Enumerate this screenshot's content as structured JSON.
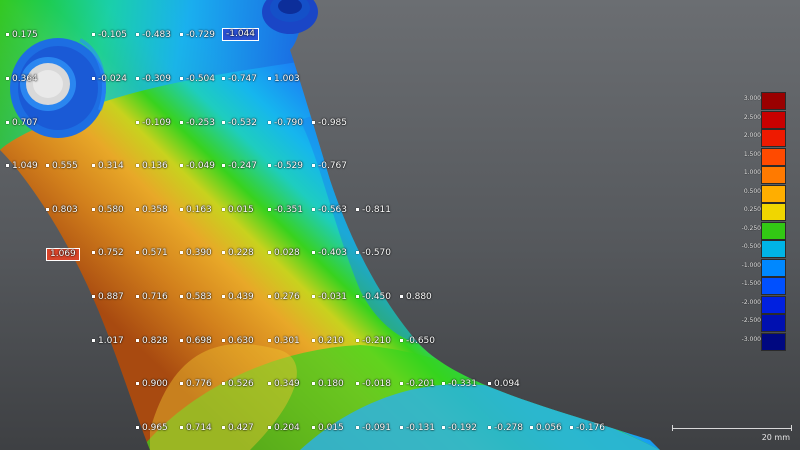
{
  "viewport": {
    "title": "",
    "model": "deviation-colormap-part"
  },
  "labels": [
    {
      "id": "r0c0",
      "text": "0.175"
    },
    {
      "id": "r0c1",
      "text": "-0.105"
    },
    {
      "id": "r0c2",
      "text": "-0.483"
    },
    {
      "id": "r0c3",
      "text": "-0.729"
    },
    {
      "id": "r0c4",
      "text": "-1.044",
      "hl": "blue"
    },
    {
      "id": "r1c0",
      "text": "0.364"
    },
    {
      "id": "r1c1",
      "text": "-0.024"
    },
    {
      "id": "r1c2",
      "text": "-0.309"
    },
    {
      "id": "r1c3",
      "text": "-0.504"
    },
    {
      "id": "r1c4",
      "text": "-0.747"
    },
    {
      "id": "r1c5",
      "text": "1.003"
    },
    {
      "id": "r2c0",
      "text": "0.707"
    },
    {
      "id": "r2c1",
      "text": "-0.109"
    },
    {
      "id": "r2c2",
      "text": "-0.253"
    },
    {
      "id": "r2c3",
      "text": "-0.532"
    },
    {
      "id": "r2c4",
      "text": "-0.790"
    },
    {
      "id": "r2c5",
      "text": "-0.985"
    },
    {
      "id": "r3c0",
      "text": "1.049"
    },
    {
      "id": "r3c1",
      "text": "0.555"
    },
    {
      "id": "r3c2",
      "text": "0.314"
    },
    {
      "id": "r3c3",
      "text": "0.136"
    },
    {
      "id": "r3c4",
      "text": "-0.049"
    },
    {
      "id": "r3c5",
      "text": "-0.247"
    },
    {
      "id": "r3c6",
      "text": "-0.529"
    },
    {
      "id": "r3c7",
      "text": "-0.767"
    },
    {
      "id": "r4c0",
      "text": "0.803"
    },
    {
      "id": "r4c1",
      "text": "0.580"
    },
    {
      "id": "r4c2",
      "text": "0.358"
    },
    {
      "id": "r4c3",
      "text": "0.163"
    },
    {
      "id": "r4c4",
      "text": "0.015"
    },
    {
      "id": "r4c5",
      "text": "-0.351"
    },
    {
      "id": "r4c6",
      "text": "-0.563"
    },
    {
      "id": "r4c7",
      "text": "-0.811"
    },
    {
      "id": "r5c0",
      "text": "1.069",
      "hl": "red"
    },
    {
      "id": "r5c1",
      "text": "0.752"
    },
    {
      "id": "r5c2",
      "text": "0.571"
    },
    {
      "id": "r5c3",
      "text": "0.390"
    },
    {
      "id": "r5c4",
      "text": "0.228"
    },
    {
      "id": "r5c5",
      "text": "0.028"
    },
    {
      "id": "r5c6",
      "text": "-0.403"
    },
    {
      "id": "r5c7",
      "text": "-0.570"
    },
    {
      "id": "r6c0",
      "text": "0.887"
    },
    {
      "id": "r6c1",
      "text": "0.716"
    },
    {
      "id": "r6c2",
      "text": "0.583"
    },
    {
      "id": "r6c3",
      "text": "0.439"
    },
    {
      "id": "r6c4",
      "text": "0.276"
    },
    {
      "id": "r6c5",
      "text": "-0.031"
    },
    {
      "id": "r6c6",
      "text": "-0.450"
    },
    {
      "id": "r6c7",
      "text": "0.880"
    },
    {
      "id": "r7c0",
      "text": "1.017"
    },
    {
      "id": "r7c1",
      "text": "0.828"
    },
    {
      "id": "r7c2",
      "text": "0.698"
    },
    {
      "id": "r7c3",
      "text": "0.630"
    },
    {
      "id": "r7c4",
      "text": "0.301"
    },
    {
      "id": "r7c5",
      "text": "0.210"
    },
    {
      "id": "r7c6",
      "text": "-0.210"
    },
    {
      "id": "r7c7",
      "text": "-0.650"
    },
    {
      "id": "r8c0",
      "text": "0.900"
    },
    {
      "id": "r8c1",
      "text": "0.776"
    },
    {
      "id": "r8c2",
      "text": "0.526"
    },
    {
      "id": "r8c3",
      "text": "0.349"
    },
    {
      "id": "r8c4",
      "text": "0.180"
    },
    {
      "id": "r8c5",
      "text": "-0.018"
    },
    {
      "id": "r8c6",
      "text": "-0.201"
    },
    {
      "id": "r8c7",
      "text": "-0.331"
    },
    {
      "id": "r8c8",
      "text": "0.094"
    },
    {
      "id": "r9c0",
      "text": "0.965"
    },
    {
      "id": "r9c1",
      "text": "0.714"
    },
    {
      "id": "r9c2",
      "text": "0.427"
    },
    {
      "id": "r9c3",
      "text": "0.204"
    },
    {
      "id": "r9c4",
      "text": "0.015"
    },
    {
      "id": "r9c5",
      "text": "-0.091"
    },
    {
      "id": "r9c6",
      "text": "-0.131"
    },
    {
      "id": "r9c7",
      "text": "-0.192"
    },
    {
      "id": "r9c8",
      "text": "-0.278"
    },
    {
      "id": "r9c9",
      "text": "0.056"
    },
    {
      "id": "r9c10",
      "text": "-0.176"
    }
  ],
  "legend": {
    "entries": [
      {
        "label": "3.000",
        "color": "#9a0000"
      },
      {
        "label": "2.500",
        "color": "#c80000"
      },
      {
        "label": "2.000",
        "color": "#ee1a00"
      },
      {
        "label": "1.500",
        "color": "#ff4a00"
      },
      {
        "label": "1.000",
        "color": "#ff7a00"
      },
      {
        "label": "0.500",
        "color": "#ffae00"
      },
      {
        "label": "0.250",
        "color": "#f0d600"
      },
      {
        "label": "-0.250",
        "color": "#32c814"
      },
      {
        "label": "-0.500",
        "color": "#00b4e6"
      },
      {
        "label": "-1.000",
        "color": "#0088ff"
      },
      {
        "label": "-1.500",
        "color": "#0050ff"
      },
      {
        "label": "-2.000",
        "color": "#0020e0"
      },
      {
        "label": "-2.500",
        "color": "#0010b0"
      },
      {
        "label": "-3.000",
        "color": "#000880"
      }
    ]
  },
  "scale_bar": {
    "label": "20 mm"
  },
  "colors": {
    "highlight_blue": "#2a4fd0",
    "highlight_red": "#d8442a",
    "background_top": "#6b6e72",
    "background_bottom": "#3e4043"
  }
}
